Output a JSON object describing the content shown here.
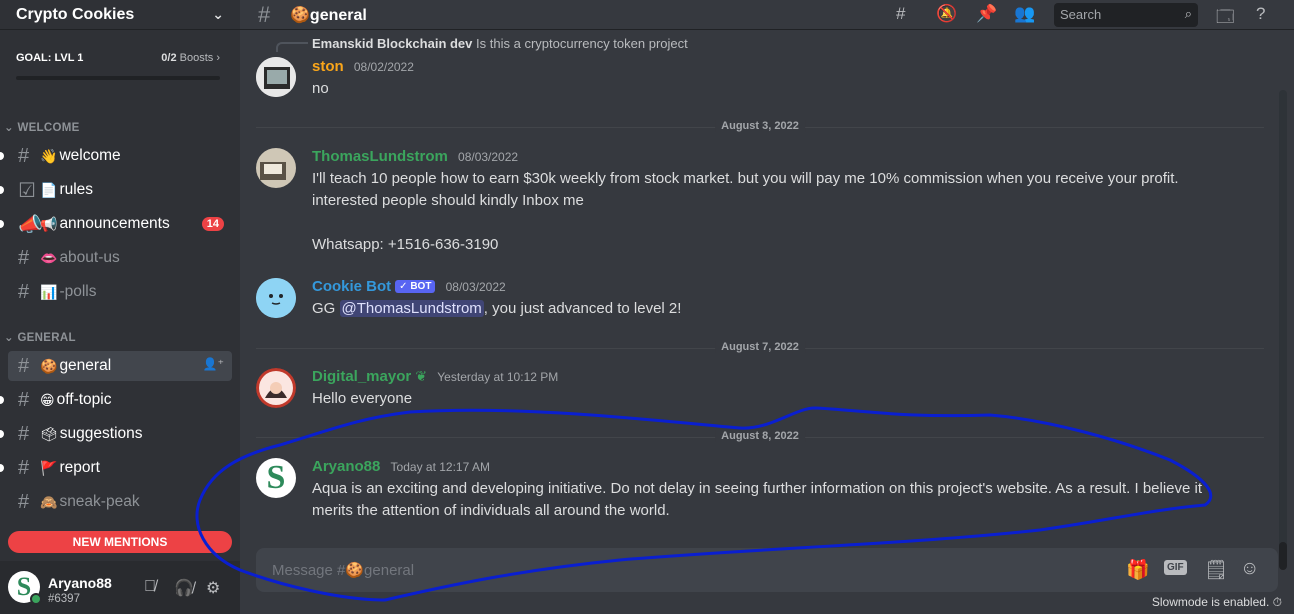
{
  "server": {
    "name": "Crypto Cookies"
  },
  "goal": {
    "label": "GOAL: LVL 1",
    "boosts_count": "0/2",
    "boosts_label": "Boosts"
  },
  "categories": {
    "welcome": "WELCOME",
    "general": "GENERAL"
  },
  "channels": [
    {
      "emoji": "👋",
      "name": "welcome"
    },
    {
      "emoji": "📄",
      "name": "rules"
    },
    {
      "emoji": "📢",
      "name": "announcements",
      "badge": "14"
    },
    {
      "emoji": "👄",
      "name": "about-us"
    },
    {
      "emoji": "📊",
      "name": "-polls"
    },
    {
      "emoji": "🍪",
      "name": "general"
    },
    {
      "emoji": "😁",
      "name": "off-topic"
    },
    {
      "emoji": "🗳",
      "name": "suggestions"
    },
    {
      "emoji": "🚩",
      "name": "report"
    },
    {
      "emoji": "🙈",
      "name": "sneak-peak"
    }
  ],
  "new_mentions": "NEW MENTIONS",
  "user": {
    "name": "Aryano88",
    "discriminator": "#6397",
    "avatar_letter": "S"
  },
  "header": {
    "channel": "🍪general",
    "search_placeholder": "Search"
  },
  "messages": {
    "reply_author": "Emanskid Blockchain dev",
    "reply_text": "Is this a cryptocurrency token project",
    "m1": {
      "author": "ston",
      "time": "08/02/2022",
      "text": "no"
    },
    "d1": "August 3, 2022",
    "m2": {
      "author": "ThomasLundstrom",
      "time": "08/03/2022",
      "text1": "I'll teach 10 people how to earn $30k weekly from stock market. but you will pay me 10% commission when you receive your profit.",
      "text2": "interested people should kindly Inbox me",
      "text3": "Whatsapp: +1516-636-3190"
    },
    "m3": {
      "author": "Cookie Bot",
      "bot_tag": "✓ BOT",
      "time": "08/03/2022",
      "prefix": "GG ",
      "mention": "@ThomasLundstrom",
      "suffix": ", you just advanced to level 2!"
    },
    "d2": "August 7, 2022",
    "m4": {
      "author": "Digital_mayor",
      "time": "Yesterday at 10:12 PM",
      "text": "Hello everyone"
    },
    "d3": "August 8, 2022",
    "m5": {
      "author": "Aryano88",
      "time": "Today at 12:17 AM",
      "text1": "Aqua is an exciting and developing initiative. Do not delay in seeing further information on this project's website. As a result. I believe it",
      "text2": "merits the attention of individuals all around the world."
    }
  },
  "composer": {
    "placeholder": "Message #🍪general",
    "gif": "GIF"
  },
  "slowmode": "Slowmode is enabled.",
  "colors": {
    "ston": "#faa61a",
    "thomas": "#3ba55d",
    "cookiebot": "#3498db",
    "digital": "#3ba55d",
    "aryano": "#3ba55d",
    "annotation": "#0a1fd0"
  }
}
